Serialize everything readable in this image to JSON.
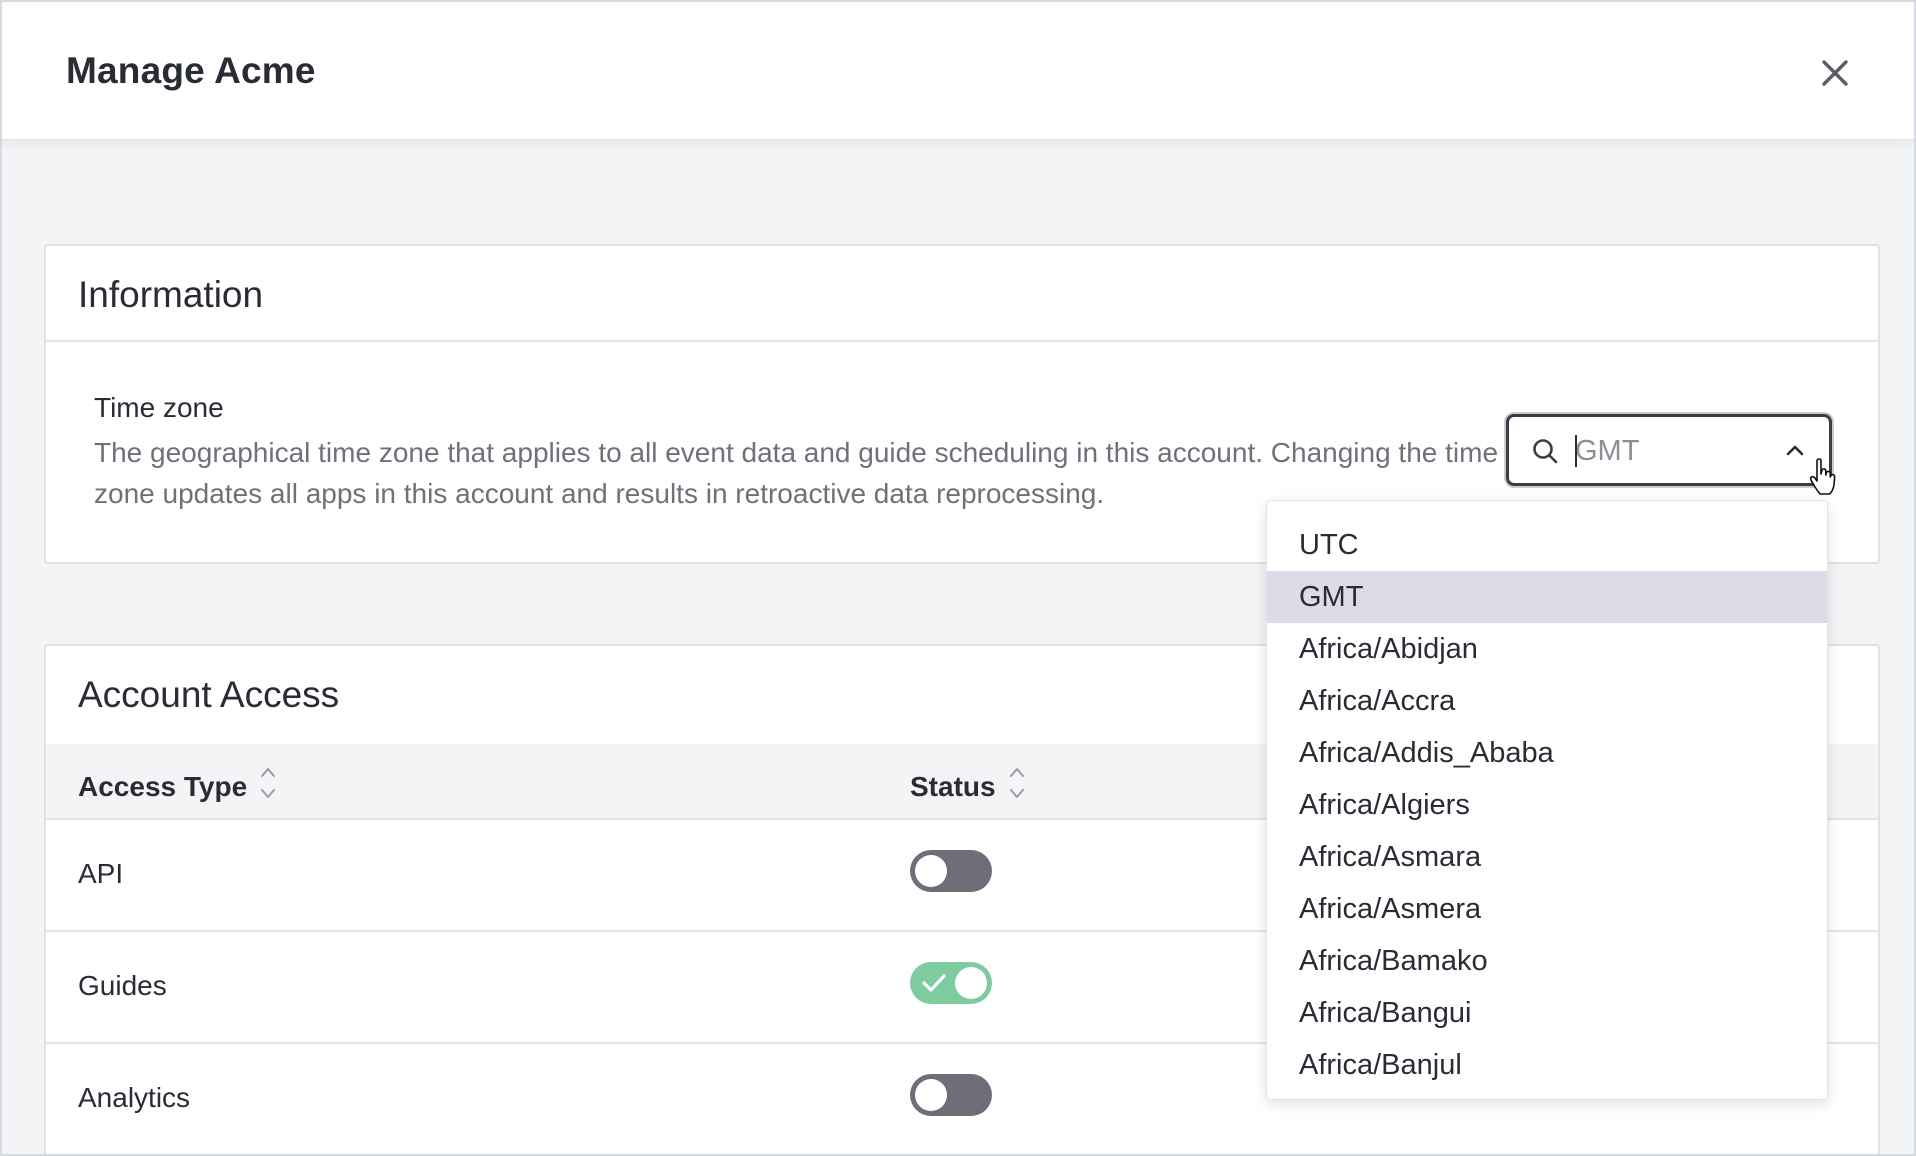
{
  "modal": {
    "title": "Manage Acme",
    "close_icon": "close-icon"
  },
  "information": {
    "title": "Information",
    "timezone": {
      "label": "Time zone",
      "description": "The geographical time zone that applies to all event data and guide scheduling in this account. Changing the time zone updates all apps in this account and results in retroactive data reprocessing.",
      "input_value": "GMT",
      "search_icon": "search-icon",
      "toggle_icon": "chevron-up-icon",
      "options": [
        "UTC",
        "GMT",
        "Africa/Abidjan",
        "Africa/Accra",
        "Africa/Addis_Ababa",
        "Africa/Algiers",
        "Africa/Asmara",
        "Africa/Asmera",
        "Africa/Bamako",
        "Africa/Bangui",
        "Africa/Banjul"
      ],
      "highlighted_option": "GMT"
    }
  },
  "account_access": {
    "title": "Account Access",
    "columns": [
      "Access Type",
      "Status"
    ],
    "rows": [
      {
        "label": "API",
        "enabled": false
      },
      {
        "label": "Guides",
        "enabled": true
      },
      {
        "label": "Analytics",
        "enabled": false
      }
    ]
  },
  "colors": {
    "toggle_on": "#7ecba0",
    "toggle_off": "#6d6e77",
    "highlight": "#dcdce6"
  }
}
